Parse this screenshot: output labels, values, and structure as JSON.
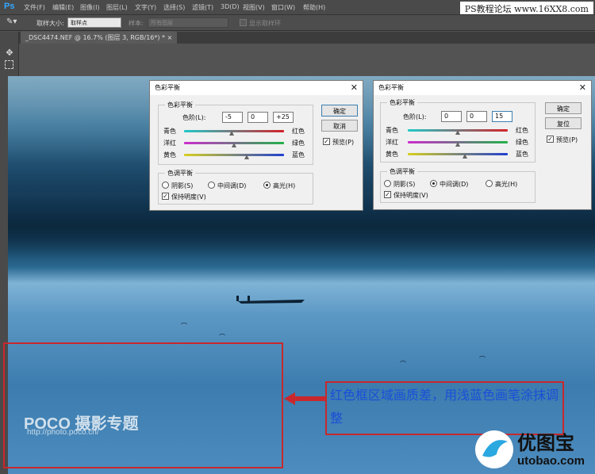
{
  "app": {
    "logo": "Ps"
  },
  "menu": [
    "文件(F)",
    "编辑(E)",
    "图像(I)",
    "图层(L)",
    "文字(Y)",
    "选择(S)",
    "滤镜(T)",
    "3D(D)",
    "视图(V)",
    "窗口(W)",
    "帮助(H)"
  ],
  "watermark_top": "PS教程论坛 www.16XX8.com",
  "options_bar": {
    "sample_size_label": "取样大小:",
    "sample_size_value": "取样点",
    "sample_label": "样本:",
    "sample_value": "所有图层",
    "show_ring_label": "显示取样环"
  },
  "document_tab": "_DSC4474.NEF @ 16.7% (图层 3, RGB/16*) *",
  "dialog_left": {
    "title": "色彩平衡",
    "group_color": "色彩平衡",
    "levels_label": "色阶(L):",
    "levels": [
      "-5",
      "0",
      "+25"
    ],
    "rows": [
      {
        "left": "青色",
        "right": "红色",
        "value": -5
      },
      {
        "left": "洋红",
        "right": "绿色",
        "value": 0
      },
      {
        "left": "黄色",
        "right": "蓝色",
        "value": 25
      }
    ],
    "group_tone": "色调平衡",
    "tones": [
      "阴影(S)",
      "中间调(D)",
      "高光(H)"
    ],
    "tone_selected": 2,
    "preserve_label": "保持明度(V)",
    "preserve_checked": true,
    "ok": "确定",
    "cancel": "取消",
    "preview_label": "预览(P)",
    "preview_checked": true
  },
  "dialog_right": {
    "title": "色彩平衡",
    "group_color": "色彩平衡",
    "levels_label": "色阶(L):",
    "levels": [
      "0",
      "0",
      "15"
    ],
    "rows": [
      {
        "left": "青色",
        "right": "红色",
        "value": 0
      },
      {
        "left": "洋红",
        "right": "绿色",
        "value": 0
      },
      {
        "left": "黄色",
        "right": "蓝色",
        "value": 15
      }
    ],
    "group_tone": "色调平衡",
    "tones": [
      "阴影(S)",
      "中间调(D)",
      "高光(H)"
    ],
    "tone_selected": 1,
    "preserve_label": "保持明度(V)",
    "preserve_checked": true,
    "ok": "确定",
    "reset": "复位",
    "preview_label": "预览(P)",
    "preview_checked": true
  },
  "annotation": "红色框区域画质差，用浅蓝色画笔涂抹调整",
  "poco": {
    "brand": "POCO 摄影专题",
    "url": "http://photo.poco.cn/"
  },
  "utobao": {
    "brand": "优图宝",
    "url": "utobao.com"
  },
  "colors": {
    "annotation_red": "#c8282d",
    "annotation_text": "#1a4fd8",
    "ps_blue": "#31a8ff"
  }
}
